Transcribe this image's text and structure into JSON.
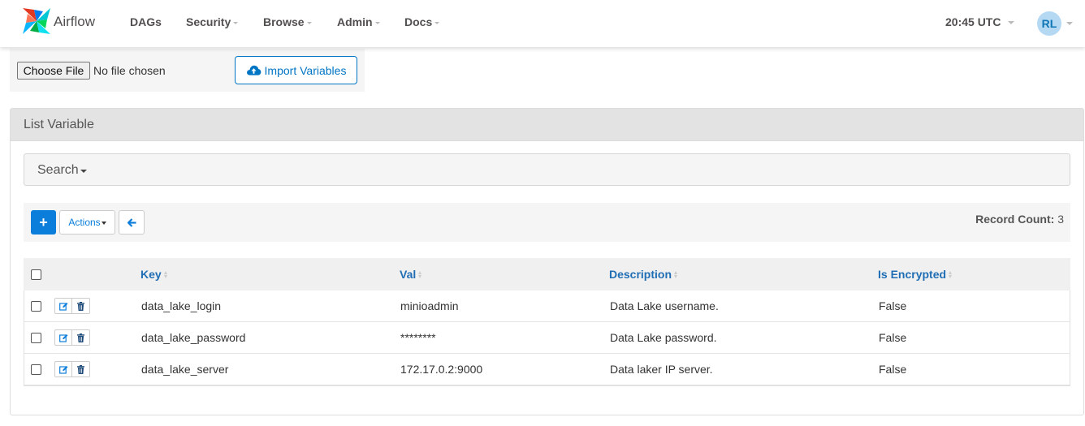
{
  "navbar": {
    "brand": "Airflow",
    "menu": [
      {
        "label": "DAGs",
        "has_caret": false
      },
      {
        "label": "Security",
        "has_caret": true
      },
      {
        "label": "Browse",
        "has_caret": true
      },
      {
        "label": "Admin",
        "has_caret": true
      },
      {
        "label": "Docs",
        "has_caret": true
      }
    ],
    "clock": "20:45 UTC",
    "user_initials": "RL"
  },
  "import": {
    "choose_file_label": "Choose File",
    "file_status": "No file chosen",
    "import_label": "Import Variables"
  },
  "list": {
    "title": "List Variable",
    "search_label": "Search",
    "toolbar": {
      "add_label": "+",
      "actions_label": "Actions",
      "record_count_label": "Record Count:",
      "record_count_value": "3"
    },
    "columns": [
      "Key",
      "Val",
      "Description",
      "Is Encrypted"
    ],
    "rows": [
      {
        "key": "data_lake_login",
        "val": "minioadmin",
        "description": "Data Lake username.",
        "is_encrypted": "False"
      },
      {
        "key": "data_lake_password",
        "val": "********",
        "description": "Data Lake password.",
        "is_encrypted": "False"
      },
      {
        "key": "data_lake_server",
        "val": "172.17.0.2:9000",
        "description": "Data laker IP server.",
        "is_encrypted": "False"
      }
    ]
  },
  "colors": {
    "accent": "#0b7dda",
    "header_link": "#1f6eb5",
    "avatar_bg": "#b6d9f3"
  },
  "icons": {
    "brand": "airflow-pinwheel-icon",
    "import": "cloud-upload-icon",
    "back": "arrow-left-icon",
    "edit": "edit-icon",
    "delete": "trash-icon"
  }
}
